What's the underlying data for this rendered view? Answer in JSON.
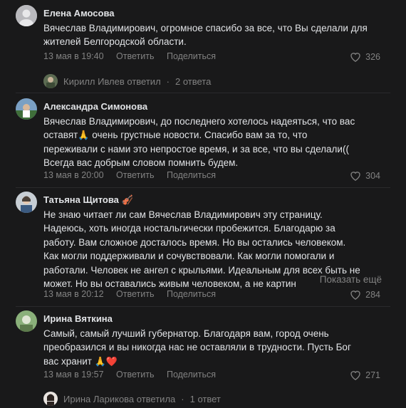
{
  "comments": [
    {
      "author": "Елена Амосова",
      "text": "Вячеслав Владимирович, огромное спасибо за все, что Вы сделали для жителей Белгородской области.",
      "date": "13 мая в 19:40",
      "reply": "Ответить",
      "share": "Поделиться",
      "likes": "326",
      "thread": {
        "user": "Кирилл Ивлев ответил",
        "count": "2 ответа"
      }
    },
    {
      "author": "Александра Симонова",
      "text_line1": "Вячеслав Владимирович, до последнего хотелось надеяться, что вас",
      "text_line2a": "оставят",
      "emoji1": "🙏",
      "text_line2b": " очень грустные новости. Спасибо вам за то, что",
      "text_line3": "переживали с нами это непростое время, и за все, что вы сделали((",
      "text_line4": "Всегда вас добрым словом помнить будем.",
      "date": "13 мая в 20:00",
      "reply": "Ответить",
      "share": "Поделиться",
      "likes": "304"
    },
    {
      "author": "Татьяна Щитова",
      "author_emoji": "🎻",
      "text": "Не знаю читает ли сам Вячеслав Владимирович эту страницу. Надеюсь, хоть иногда ностальгически пробежится. Благодарю за работу. Вам сложное досталось время. Но вы остались человеком. Как могли поддерживали и сочувствовали. Как могли помогали и работали. Человек не ангел с крыльями. Идеальным для всех быть не может. Но вы оставались живым человеком, а не картин",
      "show_more": "Показать ещё",
      "date": "13 мая в 20:12",
      "reply": "Ответить",
      "share": "Поделиться",
      "likes": "284"
    },
    {
      "author": "Ирина Вяткина",
      "text_line1": "Самый, самый лучший губернатор. Благодаря вам, город очень",
      "text_line2": "преобразился и вы никогда нас не оставляли в трудности. Пусть Бог",
      "text_line3": "вас хранит",
      "emoji": "🙏❤️",
      "date": "13 мая в 19:57",
      "reply": "Ответить",
      "share": "Поделиться",
      "likes": "271",
      "thread": {
        "user": "Ирина Ларикова ответила",
        "count": "1 ответ"
      }
    }
  ],
  "thread_separator": "·",
  "colors": {
    "background": "#19191a",
    "text": "#e1e3e6",
    "muted": "#828282"
  }
}
